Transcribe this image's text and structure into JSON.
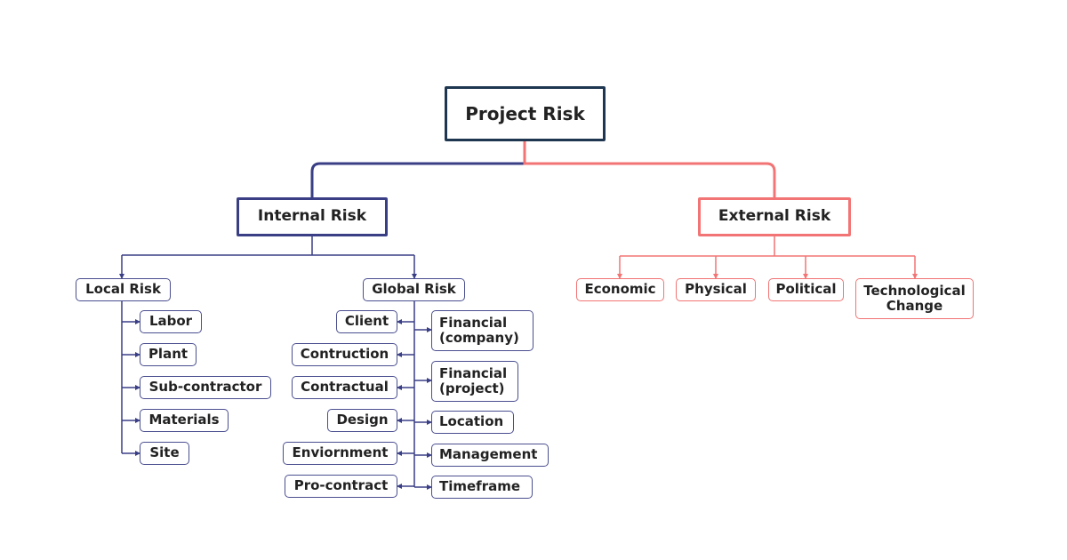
{
  "colors": {
    "root_border": "#1e3650",
    "internal": "#3a3f85",
    "external": "#f27474",
    "text": "#222222"
  },
  "root": {
    "label": "Project Risk"
  },
  "internal": {
    "label": "Internal Risk",
    "local": {
      "label": "Local Risk",
      "children": [
        "Labor",
        "Plant",
        "Sub-contractor",
        "Materials",
        "Site"
      ]
    },
    "global": {
      "label": "Global Risk",
      "left_children": [
        "Client",
        "Contruction",
        "Contractual",
        "Design",
        "Enviornment",
        "Pro-contract"
      ],
      "right_children": [
        "Financial\n(company)",
        "Financial\n(project)",
        "Location",
        "Management",
        "Timeframe"
      ]
    }
  },
  "external": {
    "label": "External Risk",
    "children": [
      "Economic",
      "Physical",
      "Political",
      "Technological\nChange"
    ]
  }
}
